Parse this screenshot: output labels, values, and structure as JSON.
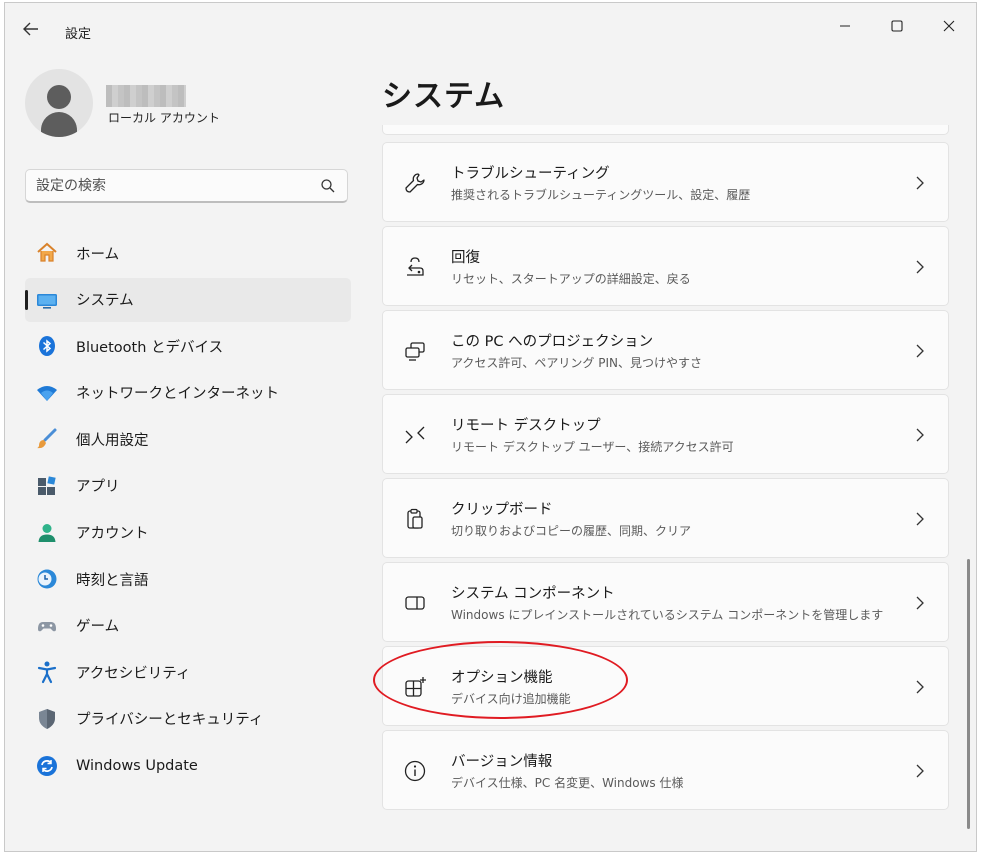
{
  "window": {
    "title": "設定"
  },
  "profile": {
    "account_type": "ローカル アカウント"
  },
  "search": {
    "placeholder": "設定の検索"
  },
  "sidebar": {
    "items": [
      {
        "label": "ホーム",
        "icon": "home-icon"
      },
      {
        "label": "システム",
        "icon": "monitor-icon",
        "selected": true
      },
      {
        "label": "Bluetooth とデバイス",
        "icon": "bluetooth-icon"
      },
      {
        "label": "ネットワークとインターネット",
        "icon": "wifi-icon"
      },
      {
        "label": "個人用設定",
        "icon": "brush-icon"
      },
      {
        "label": "アプリ",
        "icon": "apps-icon"
      },
      {
        "label": "アカウント",
        "icon": "person-icon"
      },
      {
        "label": "時刻と言語",
        "icon": "clock-globe-icon"
      },
      {
        "label": "ゲーム",
        "icon": "gamepad-icon"
      },
      {
        "label": "アクセシビリティ",
        "icon": "accessibility-icon"
      },
      {
        "label": "プライバシーとセキュリティ",
        "icon": "shield-icon"
      },
      {
        "label": "Windows Update",
        "icon": "update-icon"
      }
    ]
  },
  "main": {
    "title": "システム",
    "cards": [
      {
        "title": "トラブルシューティング",
        "desc": "推奨されるトラブルシューティングツール、設定、履歴",
        "icon": "wrench-icon"
      },
      {
        "title": "回復",
        "desc": "リセット、スタートアップの詳細設定、戻る",
        "icon": "recovery-icon"
      },
      {
        "title": "この PC へのプロジェクション",
        "desc": "アクセス許可、ペアリング PIN、見つけやすさ",
        "icon": "projection-icon"
      },
      {
        "title": "リモート デスクトップ",
        "desc": "リモート デスクトップ ユーザー、接続アクセス許可",
        "icon": "remote-desktop-icon"
      },
      {
        "title": "クリップボード",
        "desc": "切り取りおよびコピーの履歴、同期、クリア",
        "icon": "clipboard-icon"
      },
      {
        "title": "システム コンポーネント",
        "desc": "Windows にプレインストールされているシステム コンポーネントを管理します",
        "icon": "system-components-icon"
      },
      {
        "title": "オプション機能",
        "desc": "デバイス向け追加機能",
        "icon": "optional-features-icon"
      },
      {
        "title": "バージョン情報",
        "desc": "デバイス仕様、PC 名変更、Windows 仕様",
        "icon": "info-icon"
      }
    ]
  },
  "colors": {
    "accent": "#0067c0",
    "highlight": "#e01b22",
    "window_bg": "#f3f3f3",
    "card_bg": "#fbfbfb"
  }
}
